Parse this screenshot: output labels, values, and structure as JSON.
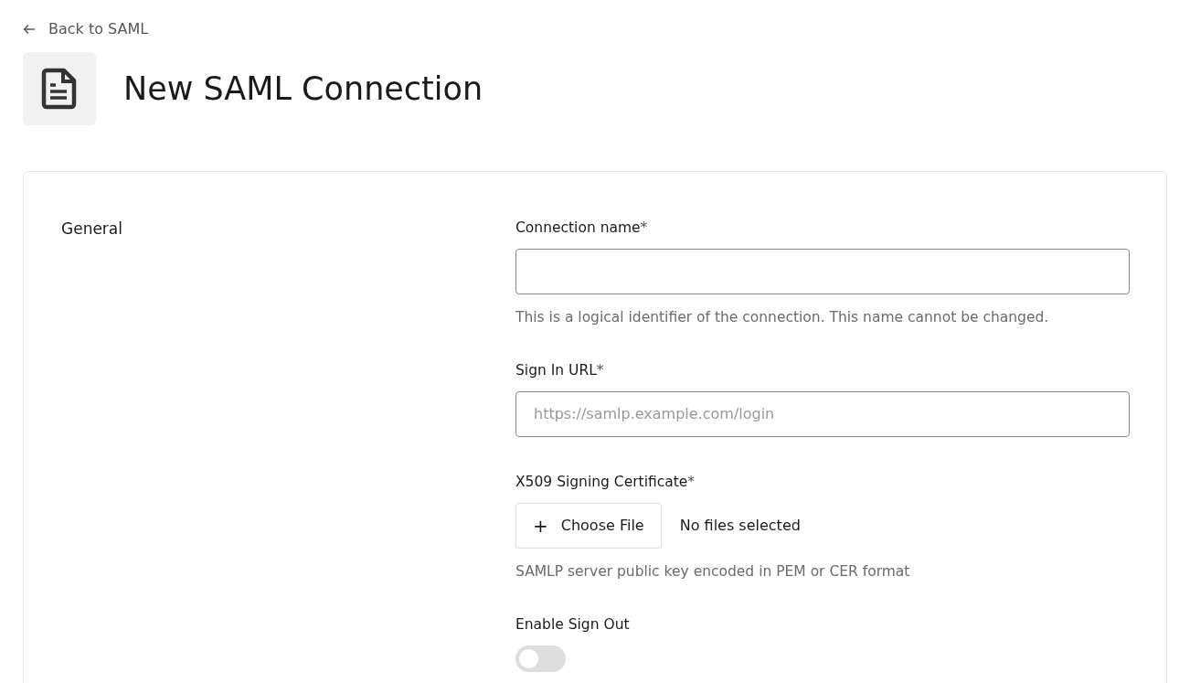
{
  "back_link": {
    "label": "Back to SAML"
  },
  "title": "New SAML Connection",
  "section": {
    "title": "General",
    "fields": [
      {
        "kind": "text",
        "label": "Connection name",
        "required_mark": "*",
        "help": "This is a logical identifier of the connection. This name cannot be changed."
      },
      {
        "kind": "text",
        "label": "Sign In URL",
        "required_mark": "*",
        "placeholder": "https://samlp.example.com/login"
      },
      {
        "kind": "file",
        "label": "X509 Signing Certificate",
        "required_mark": "*",
        "button": "Choose File",
        "button_icon": "+",
        "status": "No files selected",
        "help": "SAMLP server public key encoded in PEM or CER format"
      },
      {
        "kind": "toggle",
        "label": "Enable Sign Out",
        "on": false
      }
    ]
  }
}
